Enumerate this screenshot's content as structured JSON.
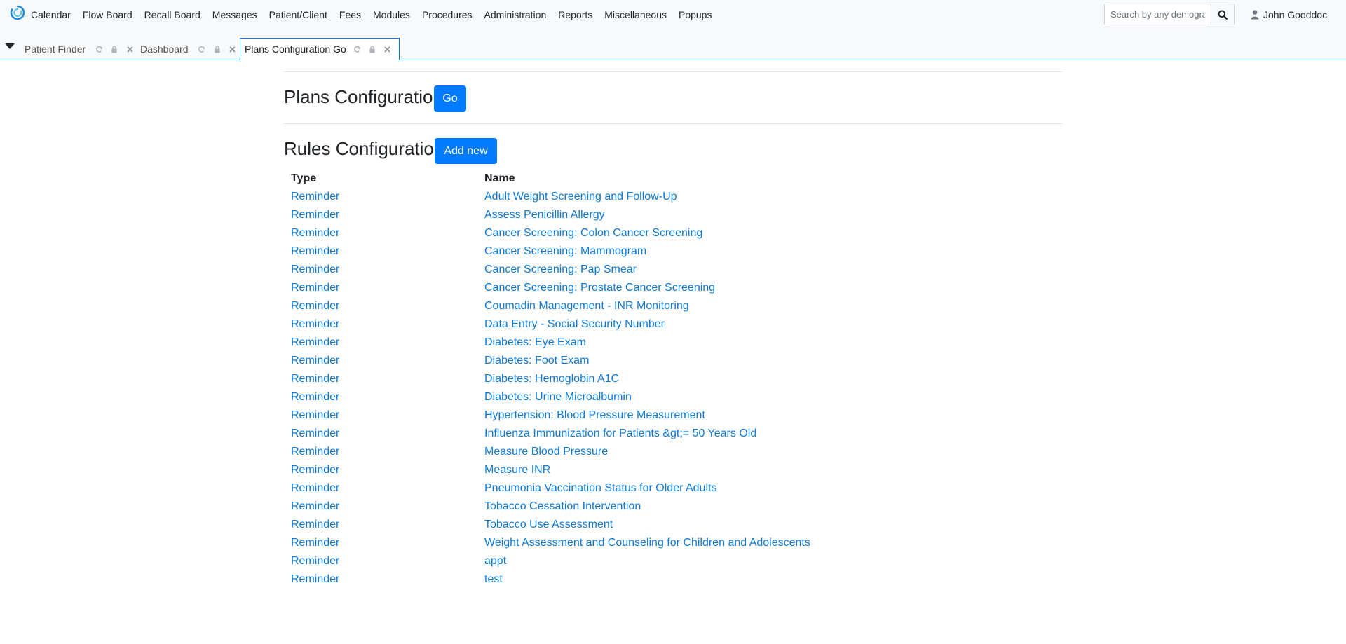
{
  "navbar": {
    "menu": [
      "Calendar",
      "Flow Board",
      "Recall Board",
      "Messages",
      "Patient/Client",
      "Fees",
      "Modules",
      "Procedures",
      "Administration",
      "Reports",
      "Miscellaneous",
      "Popups"
    ],
    "search_placeholder": "Search by any demographics",
    "search_icon": "search-icon",
    "user_name": "John Gooddoc",
    "user_icon": "user-icon"
  },
  "tabs": [
    {
      "label": "Patient Finder",
      "active": false
    },
    {
      "label": "Dashboard",
      "active": false
    },
    {
      "label": "Plans Configuration Go",
      "active": true
    }
  ],
  "plans": {
    "title": "Plans Configuration",
    "button": "Go"
  },
  "rules": {
    "title": "Rules Configuration",
    "button": "Add new",
    "columns": {
      "type": "Type",
      "name": "Name"
    },
    "rows": [
      {
        "type": "Reminder",
        "name": "Adult Weight Screening and Follow-Up"
      },
      {
        "type": "Reminder",
        "name": "Assess Penicillin Allergy"
      },
      {
        "type": "Reminder",
        "name": "Cancer Screening: Colon Cancer Screening"
      },
      {
        "type": "Reminder",
        "name": "Cancer Screening: Mammogram"
      },
      {
        "type": "Reminder",
        "name": "Cancer Screening: Pap Smear"
      },
      {
        "type": "Reminder",
        "name": "Cancer Screening: Prostate Cancer Screening"
      },
      {
        "type": "Reminder",
        "name": "Coumadin Management - INR Monitoring"
      },
      {
        "type": "Reminder",
        "name": "Data Entry - Social Security Number"
      },
      {
        "type": "Reminder",
        "name": "Diabetes: Eye Exam"
      },
      {
        "type": "Reminder",
        "name": "Diabetes: Foot Exam"
      },
      {
        "type": "Reminder",
        "name": "Diabetes: Hemoglobin A1C"
      },
      {
        "type": "Reminder",
        "name": "Diabetes: Urine Microalbumin"
      },
      {
        "type": "Reminder",
        "name": "Hypertension: Blood Pressure Measurement"
      },
      {
        "type": "Reminder",
        "name": "Influenza Immunization for Patients &gt;= 50 Years Old"
      },
      {
        "type": "Reminder",
        "name": "Measure Blood Pressure"
      },
      {
        "type": "Reminder",
        "name": "Measure INR"
      },
      {
        "type": "Reminder",
        "name": "Pneumonia Vaccination Status for Older Adults"
      },
      {
        "type": "Reminder",
        "name": "Tobacco Cessation Intervention"
      },
      {
        "type": "Reminder",
        "name": "Tobacco Use Assessment"
      },
      {
        "type": "Reminder",
        "name": "Weight Assessment and Counseling for Children and Adolescents"
      },
      {
        "type": "Reminder",
        "name": "appt"
      },
      {
        "type": "Reminder",
        "name": "test"
      }
    ]
  },
  "colors": {
    "primary": "#007bff",
    "link": "#0c7ad9",
    "navbar_bg": "#f8f9fa"
  }
}
